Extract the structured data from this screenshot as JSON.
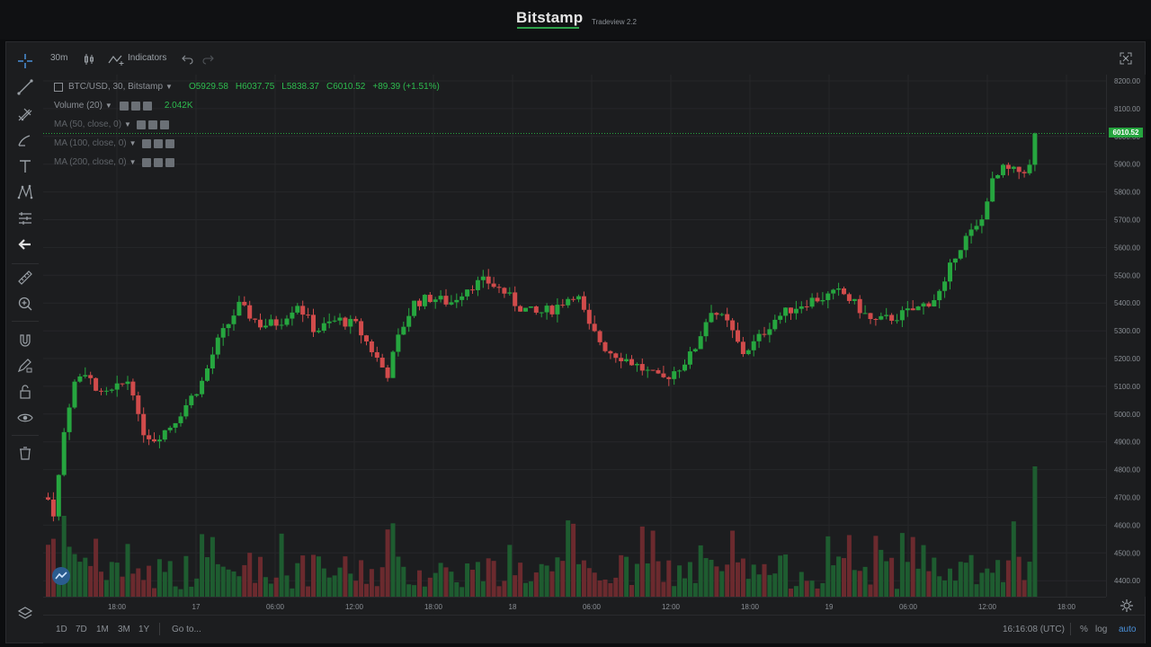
{
  "header": {
    "brand": "Bitstamp",
    "subtitle": "Tradeview 2.2"
  },
  "toolbar_top": {
    "interval": "30m",
    "indicators_label": "Indicators"
  },
  "left_tools": [
    {
      "name": "crosshair-icon"
    },
    {
      "name": "trend-line-icon"
    },
    {
      "name": "fib-tool-icon"
    },
    {
      "name": "brush-icon"
    },
    {
      "name": "text-tool-icon"
    },
    {
      "name": "pattern-icon"
    },
    {
      "name": "prediction-icon"
    },
    {
      "name": "arrow-left-icon"
    },
    {
      "name": "ruler-icon"
    },
    {
      "name": "zoom-in-icon"
    },
    {
      "name": "magnet-icon"
    },
    {
      "name": "pencil-lock-icon"
    },
    {
      "name": "lock-icon"
    },
    {
      "name": "eye-icon"
    },
    {
      "name": "trash-icon"
    }
  ],
  "legend": {
    "symbol": "BTC/USD, 30, Bitstamp",
    "open": "O5929.58",
    "high": "H6037.75",
    "low": "L5838.37",
    "close": "C6010.52",
    "change": "+89.39 (+1.51%)",
    "volume_label": "Volume (20)",
    "volume_value": "2.042K",
    "ma50": "MA (50, close, 0)",
    "ma100": "MA (100, close, 0)",
    "ma200": "MA (200, close, 0)"
  },
  "price_tag": "6010.52",
  "chart_data": {
    "type": "candlestick",
    "y_ticks": [
      "8200.00",
      "8100.00",
      "6000.00",
      "5900.00",
      "5800.00",
      "5700.00",
      "5600.00",
      "5500.00",
      "5400.00",
      "5300.00",
      "5200.00",
      "5100.00",
      "5000.00",
      "4900.00",
      "4800.00",
      "4700.00",
      "4600.00",
      "4500.00",
      "4400.00"
    ],
    "x_ticks": [
      "18:00",
      "17",
      "06:00",
      "12:00",
      "18:00",
      "18",
      "06:00",
      "12:00",
      "18:00",
      "19",
      "06:00",
      "12:00",
      "18:00"
    ],
    "last_price": 6010.52,
    "colors": {
      "up": "#26a63f",
      "down": "#d14b4b",
      "up_vol": "#1e5c30",
      "down_vol": "#6b2a2e"
    }
  },
  "time_axis": {
    "current_time": "16:16:08 (UTC)"
  },
  "bottom_bar": {
    "ranges": [
      "1D",
      "7D",
      "1M",
      "3M",
      "1Y"
    ],
    "goto": "Go to...",
    "percent": "%",
    "log": "log",
    "auto": "auto"
  }
}
